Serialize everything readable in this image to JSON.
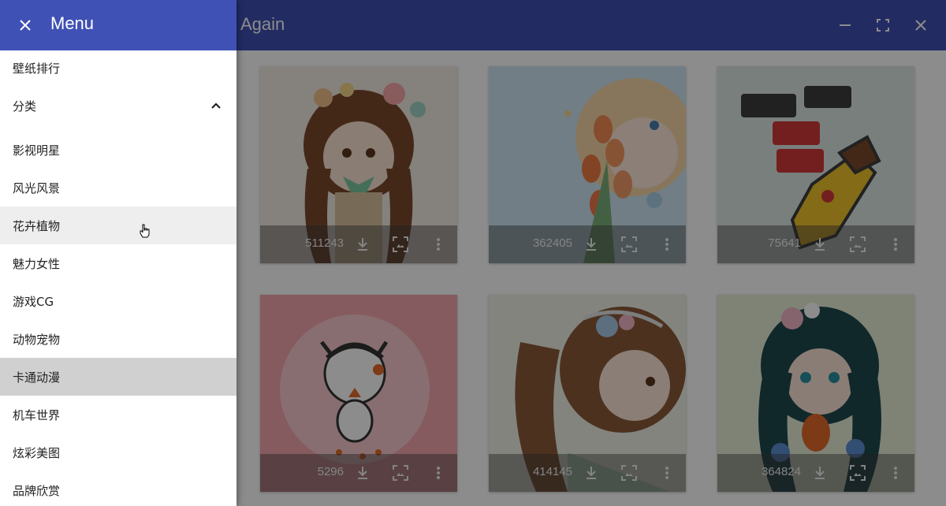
{
  "app": {
    "title": "Again",
    "colors": {
      "primary": "#3f51b5",
      "hover": "#eeeeee",
      "selected": "#d0d0d0"
    }
  },
  "window_controls": [
    {
      "name": "minimize",
      "icon": "minimize-icon"
    },
    {
      "name": "maximize",
      "icon": "fullscreen-icon"
    },
    {
      "name": "close",
      "icon": "close-icon"
    }
  ],
  "drawer": {
    "title": "Menu",
    "close_icon": "close-icon",
    "items": [
      {
        "label": "壁纸排行"
      },
      {
        "label": "分类",
        "expanded": true,
        "icon": "chevron-up-icon"
      },
      {
        "label": "影视明星"
      },
      {
        "label": "风光风景"
      },
      {
        "label": "花卉植物",
        "state": "hover"
      },
      {
        "label": "魅力女性"
      },
      {
        "label": "游戏CG"
      },
      {
        "label": "动物宠物"
      },
      {
        "label": "卡通动漫",
        "state": "selected"
      },
      {
        "label": "机车世界"
      },
      {
        "label": "炫彩美图"
      },
      {
        "label": "品牌欣赏"
      }
    ]
  },
  "wallpapers": [
    {
      "count": "511243",
      "theme": "anime-girl-flowers-brown-hair"
    },
    {
      "count": "362405",
      "theme": "anime-girl-tulips-blonde"
    },
    {
      "count": "75641",
      "theme": "cartoon-pencil-character-text"
    },
    {
      "count": "5296",
      "theme": "cartoon-kid-pink-background"
    },
    {
      "count": "414145",
      "theme": "anime-girl-lace-brown-hair"
    },
    {
      "count": "364824",
      "theme": "anime-girl-teal-hair-flowers"
    }
  ],
  "card_actions": [
    "download-icon",
    "set-wallpaper-icon",
    "more-vert-icon"
  ]
}
